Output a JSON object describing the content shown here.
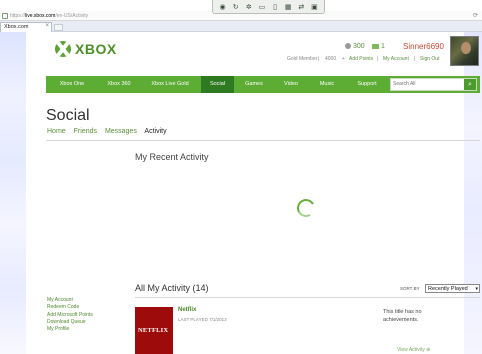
{
  "toolbar_icons": [
    "record-icon",
    "rotate-icon",
    "settings-icon",
    "chat-icon",
    "monitor-icon",
    "grid-icon",
    "transfer-icon",
    "window-icon"
  ],
  "browser": {
    "url_prefix": "https://",
    "url_domain": "live.xbox.com",
    "url_path": "/en-US/Activity",
    "tab_title": "Xbox.com"
  },
  "header": {
    "logo_text": "XBOX",
    "points": "300",
    "messages": "1",
    "gamertag": "Sinner6690",
    "membership": "Gold Member",
    "gamerscore": "4000",
    "add_points": "Add Points",
    "my_account": "My Account",
    "sign_out": "Sign Out",
    "separator": "|"
  },
  "nav": {
    "items": [
      "Xbox One",
      "Xbox 360",
      "Xbox Live Gold",
      "Social",
      "Games",
      "Video",
      "Music",
      "Support"
    ],
    "active": "Social",
    "search_placeholder": "Search All"
  },
  "page": {
    "title": "Social",
    "subnav": [
      "Home",
      "Friends",
      "Messages",
      "Activity"
    ],
    "subnav_active": "Activity",
    "recent_heading": "My Recent Activity",
    "all_activity": "All My Activity (14)",
    "sort_label": "SORT BY",
    "sort_value": "Recently Played"
  },
  "left_links": [
    "My Account",
    "Redeem Code",
    "Add Microsoft Points",
    "Download Queue",
    "My Profile"
  ],
  "activity_item": {
    "name": "Netflix",
    "last_played": "LAST PLAYED 7/1/2013",
    "achievements_note": "This title has no achievements.",
    "tile_text": "NETFLIX",
    "view_activity": "View Activity"
  }
}
